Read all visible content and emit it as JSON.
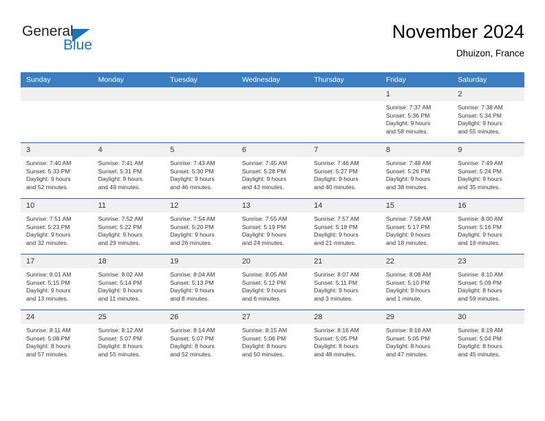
{
  "brand": {
    "name_part1": "General",
    "name_part2": "Blue",
    "triangle_color": "#1b75bb",
    "text_color": "#231f20"
  },
  "header": {
    "title": "November 2024",
    "subtitle": "Dhuizon, France"
  },
  "theme": {
    "header_bg": "#3a7ebf",
    "daynum_bg": "#f0f0f0",
    "row_divider": "#2c5f8f",
    "body_text": "#333333"
  },
  "weekday_headers": [
    "Sunday",
    "Monday",
    "Tuesday",
    "Wednesday",
    "Thursday",
    "Friday",
    "Saturday"
  ],
  "weeks": [
    [
      {
        "day": "",
        "lines": []
      },
      {
        "day": "",
        "lines": []
      },
      {
        "day": "",
        "lines": []
      },
      {
        "day": "",
        "lines": []
      },
      {
        "day": "",
        "lines": []
      },
      {
        "day": "1",
        "lines": [
          "Sunrise: 7:37 AM",
          "Sunset: 5:36 PM",
          "Daylight: 9 hours",
          "and 58 minutes."
        ]
      },
      {
        "day": "2",
        "lines": [
          "Sunrise: 7:38 AM",
          "Sunset: 5:34 PM",
          "Daylight: 9 hours",
          "and 55 minutes."
        ]
      }
    ],
    [
      {
        "day": "3",
        "lines": [
          "Sunrise: 7:40 AM",
          "Sunset: 5:33 PM",
          "Daylight: 9 hours",
          "and 52 minutes."
        ]
      },
      {
        "day": "4",
        "lines": [
          "Sunrise: 7:41 AM",
          "Sunset: 5:31 PM",
          "Daylight: 9 hours",
          "and 49 minutes."
        ]
      },
      {
        "day": "5",
        "lines": [
          "Sunrise: 7:43 AM",
          "Sunset: 5:30 PM",
          "Daylight: 9 hours",
          "and 46 minutes."
        ]
      },
      {
        "day": "6",
        "lines": [
          "Sunrise: 7:45 AM",
          "Sunset: 5:28 PM",
          "Daylight: 9 hours",
          "and 43 minutes."
        ]
      },
      {
        "day": "7",
        "lines": [
          "Sunrise: 7:46 AM",
          "Sunset: 5:27 PM",
          "Daylight: 9 hours",
          "and 40 minutes."
        ]
      },
      {
        "day": "8",
        "lines": [
          "Sunrise: 7:48 AM",
          "Sunset: 5:26 PM",
          "Daylight: 9 hours",
          "and 38 minutes."
        ]
      },
      {
        "day": "9",
        "lines": [
          "Sunrise: 7:49 AM",
          "Sunset: 5:24 PM",
          "Daylight: 9 hours",
          "and 35 minutes."
        ]
      }
    ],
    [
      {
        "day": "10",
        "lines": [
          "Sunrise: 7:51 AM",
          "Sunset: 5:23 PM",
          "Daylight: 9 hours",
          "and 32 minutes."
        ]
      },
      {
        "day": "11",
        "lines": [
          "Sunrise: 7:52 AM",
          "Sunset: 5:22 PM",
          "Daylight: 9 hours",
          "and 29 minutes."
        ]
      },
      {
        "day": "12",
        "lines": [
          "Sunrise: 7:54 AM",
          "Sunset: 5:20 PM",
          "Daylight: 9 hours",
          "and 26 minutes."
        ]
      },
      {
        "day": "13",
        "lines": [
          "Sunrise: 7:55 AM",
          "Sunset: 5:19 PM",
          "Daylight: 9 hours",
          "and 24 minutes."
        ]
      },
      {
        "day": "14",
        "lines": [
          "Sunrise: 7:57 AM",
          "Sunset: 5:18 PM",
          "Daylight: 9 hours",
          "and 21 minutes."
        ]
      },
      {
        "day": "15",
        "lines": [
          "Sunrise: 7:58 AM",
          "Sunset: 5:17 PM",
          "Daylight: 9 hours",
          "and 18 minutes."
        ]
      },
      {
        "day": "16",
        "lines": [
          "Sunrise: 8:00 AM",
          "Sunset: 5:16 PM",
          "Daylight: 9 hours",
          "and 16 minutes."
        ]
      }
    ],
    [
      {
        "day": "17",
        "lines": [
          "Sunrise: 8:01 AM",
          "Sunset: 5:15 PM",
          "Daylight: 9 hours",
          "and 13 minutes."
        ]
      },
      {
        "day": "18",
        "lines": [
          "Sunrise: 8:02 AM",
          "Sunset: 5:14 PM",
          "Daylight: 9 hours",
          "and 11 minutes."
        ]
      },
      {
        "day": "19",
        "lines": [
          "Sunrise: 8:04 AM",
          "Sunset: 5:13 PM",
          "Daylight: 9 hours",
          "and 8 minutes."
        ]
      },
      {
        "day": "20",
        "lines": [
          "Sunrise: 8:05 AM",
          "Sunset: 5:12 PM",
          "Daylight: 9 hours",
          "and 6 minutes."
        ]
      },
      {
        "day": "21",
        "lines": [
          "Sunrise: 8:07 AM",
          "Sunset: 5:11 PM",
          "Daylight: 9 hours",
          "and 3 minutes."
        ]
      },
      {
        "day": "22",
        "lines": [
          "Sunrise: 8:08 AM",
          "Sunset: 5:10 PM",
          "Daylight: 9 hours",
          "and 1 minute."
        ]
      },
      {
        "day": "23",
        "lines": [
          "Sunrise: 8:10 AM",
          "Sunset: 5:09 PM",
          "Daylight: 8 hours",
          "and 59 minutes."
        ]
      }
    ],
    [
      {
        "day": "24",
        "lines": [
          "Sunrise: 8:11 AM",
          "Sunset: 5:08 PM",
          "Daylight: 8 hours",
          "and 57 minutes."
        ]
      },
      {
        "day": "25",
        "lines": [
          "Sunrise: 8:12 AM",
          "Sunset: 5:07 PM",
          "Daylight: 8 hours",
          "and 55 minutes."
        ]
      },
      {
        "day": "26",
        "lines": [
          "Sunrise: 8:14 AM",
          "Sunset: 5:07 PM",
          "Daylight: 8 hours",
          "and 52 minutes."
        ]
      },
      {
        "day": "27",
        "lines": [
          "Sunrise: 8:15 AM",
          "Sunset: 5:06 PM",
          "Daylight: 8 hours",
          "and 50 minutes."
        ]
      },
      {
        "day": "28",
        "lines": [
          "Sunrise: 8:16 AM",
          "Sunset: 5:05 PM",
          "Daylight: 8 hours",
          "and 48 minutes."
        ]
      },
      {
        "day": "29",
        "lines": [
          "Sunrise: 8:18 AM",
          "Sunset: 5:05 PM",
          "Daylight: 8 hours",
          "and 47 minutes."
        ]
      },
      {
        "day": "30",
        "lines": [
          "Sunrise: 8:19 AM",
          "Sunset: 5:04 PM",
          "Daylight: 8 hours",
          "and 45 minutes."
        ]
      }
    ]
  ]
}
